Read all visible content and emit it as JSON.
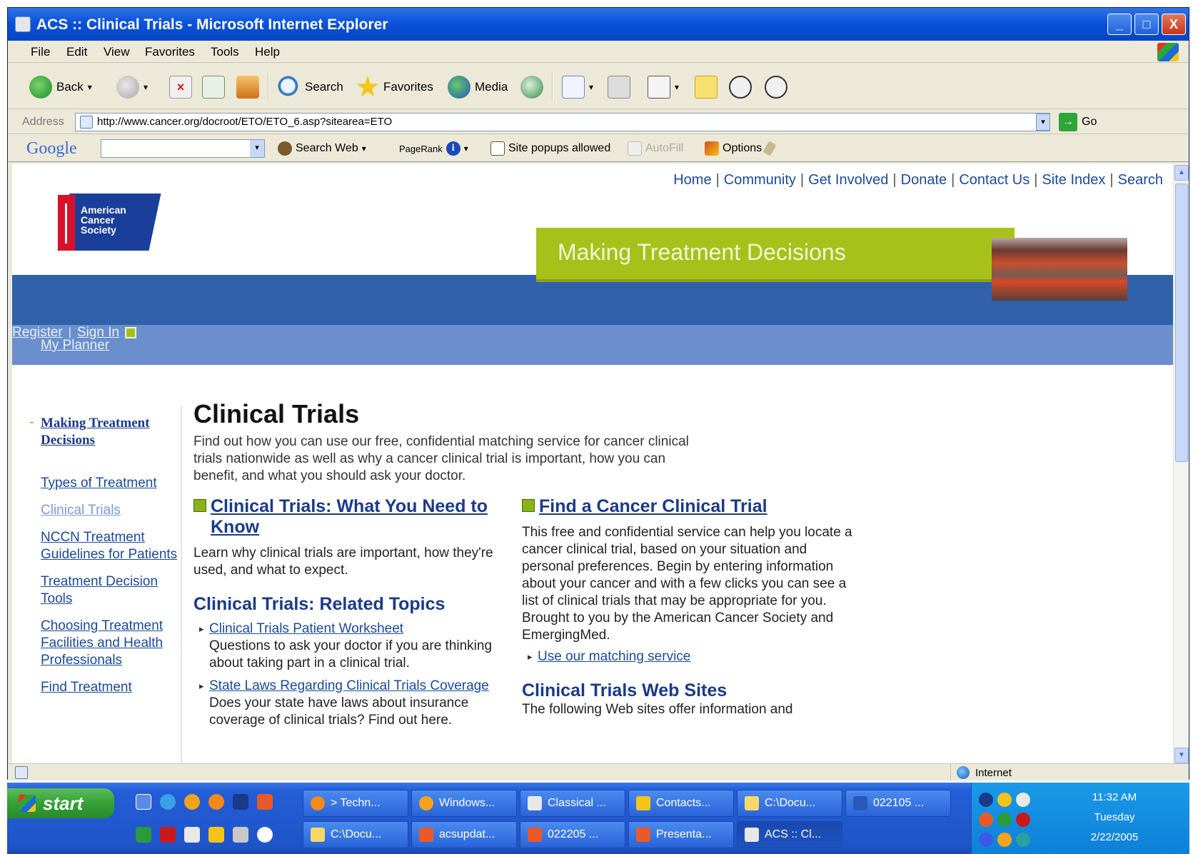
{
  "window": {
    "title": "ACS :: Clinical Trials - Microsoft Internet Explorer",
    "minimize": "_",
    "maximize": "□",
    "close": "X"
  },
  "menu": [
    "File",
    "Edit",
    "View",
    "Favorites",
    "Tools",
    "Help"
  ],
  "toolbar": {
    "back": "Back",
    "search": "Search",
    "favorites": "Favorites",
    "media": "Media",
    "dropdown_glyph": "▾"
  },
  "address": {
    "label": "Address",
    "url": "http://www.cancer.org/docroot/ETO/ETO_6.asp?sitearea=ETO",
    "go": "Go"
  },
  "googlebar": {
    "logo": "Google",
    "search_web": "Search Web",
    "pagerank": "PageRank",
    "popups": "Site popups allowed",
    "autofill": "AutoFill",
    "options": "Options"
  },
  "page": {
    "toplinks": [
      "Home",
      "Community",
      "Get Involved",
      "Donate",
      "Contact Us",
      "Site Index",
      "Search"
    ],
    "logo_text": "American\nCancer\nSociety",
    "banner_title": "Making Treatment Decisions",
    "my_planner": "My Planner",
    "register": "Register",
    "register_sep": "|",
    "sign_in": "Sign In",
    "leftnav": {
      "section_title": "Making Treatment Decisions",
      "items": [
        "Types of Treatment",
        "Clinical Trials",
        "NCCN Treatment Guidelines for Patients",
        "Treatment Decision Tools",
        "Choosing Treatment Facilities and Health Professionals",
        "Find Treatment"
      ]
    },
    "title": "Clinical Trials",
    "intro": "Find out how you can use our free, confidential matching service for cancer clinical trials nationwide as well as why a cancer clinical trial is important, how you can benefit, and what you should ask your doctor.",
    "need_to_know": {
      "heading": "Clinical Trials: What You Need to Know",
      "desc": "Learn why clinical trials are important, how they're used, and what to expect."
    },
    "related": {
      "heading": "Clinical Trials: Related Topics",
      "items": [
        {
          "link": "Clinical Trials Patient Worksheet",
          "desc": "Questions to ask your doctor if you are thinking about taking part in a clinical trial."
        },
        {
          "link": "State Laws Regarding Clinical Trials Coverage",
          "desc": "Does your state have laws about insurance coverage of clinical trials? Find out here."
        }
      ]
    },
    "find_trial": {
      "heading": "Find a Cancer Clinical Trial",
      "desc": "This free and confidential service can help you locate a cancer clinical trial, based on your situation and personal preferences. Begin by entering information about your cancer and with a few clicks you can see a list of clinical trials that may be appropriate for you. Brought to you by the American Cancer Society and EmergingMed.",
      "link": "Use our matching service"
    },
    "websites": {
      "heading": "Clinical Trials Web Sites",
      "desc": "The following Web sites offer information and"
    }
  },
  "status": {
    "zone": "Internet"
  },
  "taskbar": {
    "start": "start",
    "row1": [
      "> Techn...",
      "Windows...",
      "Classical ...",
      "Contacts...",
      "C:\\Docu...",
      "022105 ..."
    ],
    "row2": [
      "C:\\Docu...",
      "acsupdat...",
      "022205 ...",
      "Presenta...",
      "ACS :: Cl..."
    ],
    "clock_time": "11:32 AM",
    "clock_day": "Tuesday",
    "clock_date": "2/22/2005"
  }
}
